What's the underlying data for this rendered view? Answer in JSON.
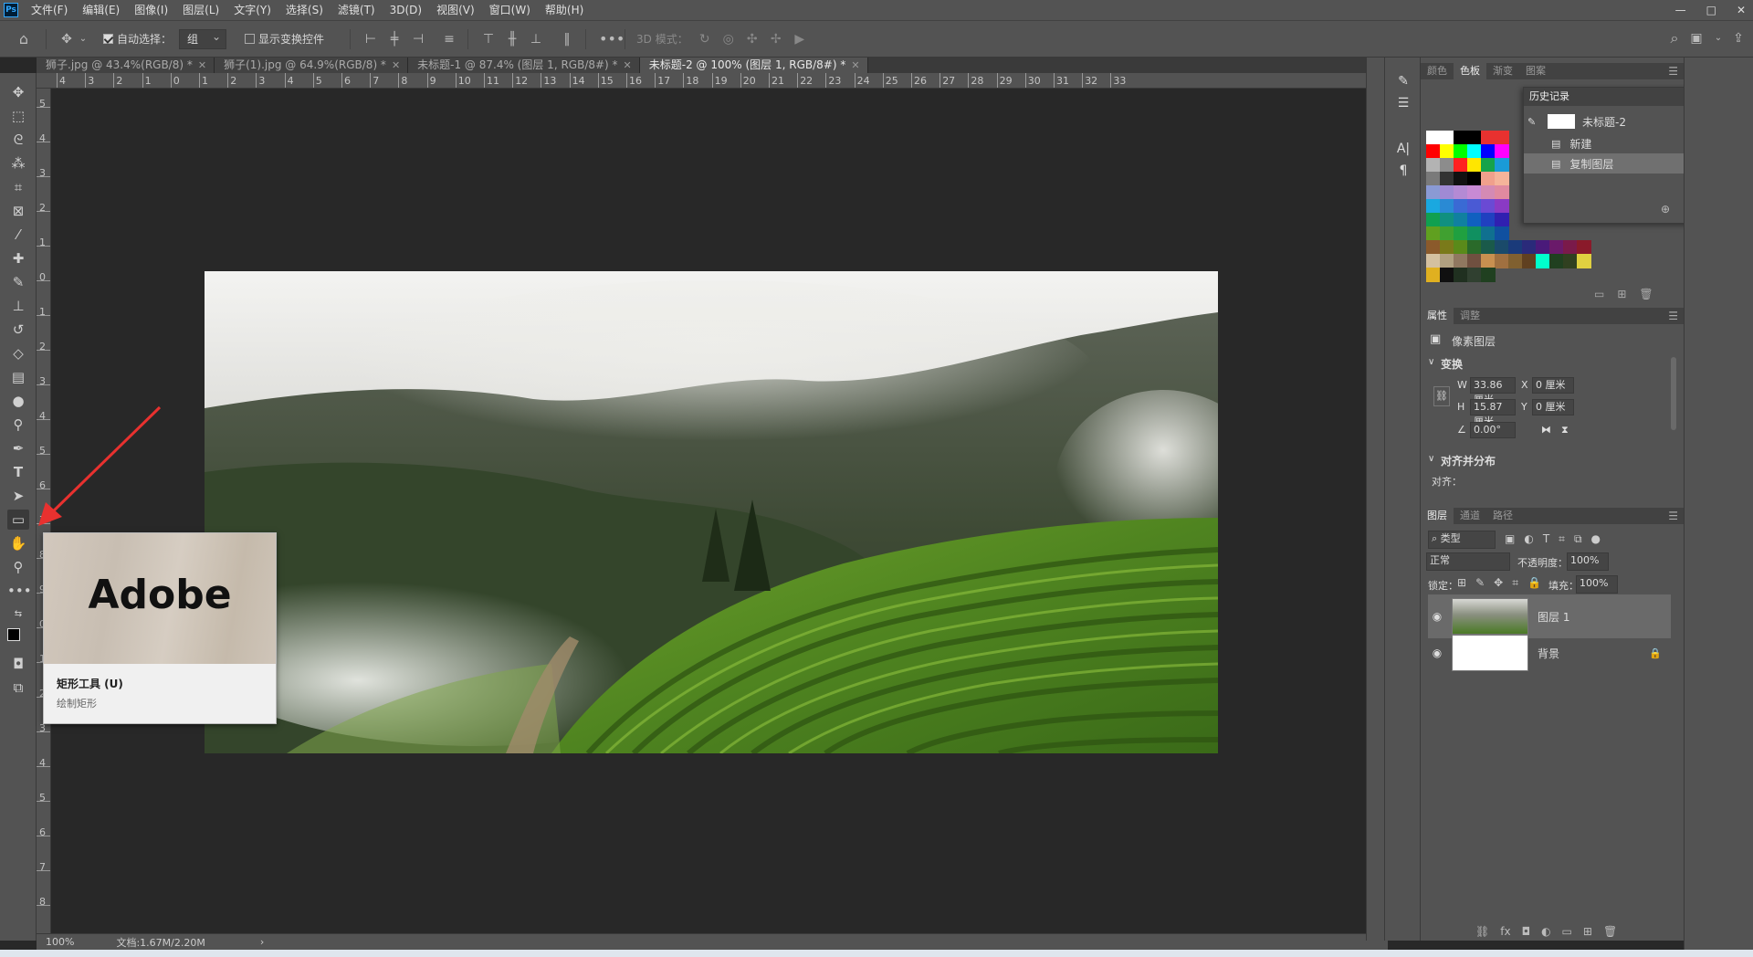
{
  "app": {
    "logo": "Ps"
  },
  "menu": [
    "文件(F)",
    "编辑(E)",
    "图像(I)",
    "图层(L)",
    "文字(Y)",
    "选择(S)",
    "滤镜(T)",
    "3D(D)",
    "视图(V)",
    "窗口(W)",
    "帮助(H)"
  ],
  "window_controls": [
    "—",
    "□",
    "✕"
  ],
  "options": {
    "auto_select_label": "自动选择：",
    "auto_select_value": "组",
    "show_transform_label": "显示变换控件",
    "mode_3d_label": "3D 模式："
  },
  "tabs": [
    {
      "label": "狮子.jpg @ 43.4%(RGB/8) *",
      "active": false
    },
    {
      "label": "狮子(1).jpg @ 64.9%(RGB/8) *",
      "active": false
    },
    {
      "label": "未标题-1 @ 87.4% (图层 1, RGB/8#) *",
      "active": false
    },
    {
      "label": "未标题-2 @ 100% (图层 1, RGB/8#) *",
      "active": true
    }
  ],
  "ruler_h": [
    "4",
    "3",
    "2",
    "1",
    "0",
    "1",
    "2",
    "3",
    "4",
    "5",
    "6",
    "7",
    "8",
    "9",
    "10",
    "11",
    "12",
    "13",
    "14",
    "15",
    "16",
    "17",
    "18",
    "19",
    "20",
    "21",
    "22",
    "23",
    "24",
    "25",
    "26",
    "27",
    "28",
    "29",
    "30",
    "31",
    "32",
    "33"
  ],
  "ruler_v": [
    "5",
    "4",
    "3",
    "2",
    "1",
    "0",
    "1",
    "2",
    "3",
    "4",
    "5",
    "6",
    "7",
    "8",
    "9",
    "0",
    "1",
    "2",
    "3",
    "4",
    "5",
    "6",
    "7",
    "8"
  ],
  "tooltip": {
    "brand": "Adobe",
    "title": "矩形工具 (U)",
    "desc": "绘制矩形"
  },
  "status": {
    "zoom": "100%",
    "doc": "文档:1.67M/2.20M",
    "arrow": "›"
  },
  "swatch_panel": {
    "tabs": [
      "颜色",
      "色板",
      "渐变",
      "图案"
    ],
    "active": "色板"
  },
  "history": {
    "title": "历史记录",
    "snapshot": "未标题-2",
    "items": [
      "新建",
      "复制图层"
    ]
  },
  "properties": {
    "tabs": [
      "属性",
      "调整"
    ],
    "type_label": "像素图层",
    "transform_title": "变换",
    "w_label": "W",
    "w_value": "33.86 厘米",
    "h_label": "H",
    "h_value": "15.87 厘米",
    "x_label": "X",
    "x_value": "0 厘米",
    "y_label": "Y",
    "y_value": "0 厘米",
    "angle_value": "0.00°",
    "align_title": "对齐并分布",
    "align_label": "对齐："
  },
  "layers_panel": {
    "tabs": [
      "图层",
      "通道",
      "路径"
    ],
    "filter_label": "类型",
    "blend_mode": "正常",
    "opacity_label": "不透明度：",
    "opacity_value": "100%",
    "lock_label": "锁定：",
    "fill_label": "填充：",
    "fill_value": "100%",
    "layers": [
      {
        "name": "图层 1",
        "selected": true
      },
      {
        "name": "背景",
        "selected": false
      }
    ]
  },
  "colors": {
    "bg": "#282828",
    "panel": "#535353",
    "accent": "#e8312f"
  }
}
